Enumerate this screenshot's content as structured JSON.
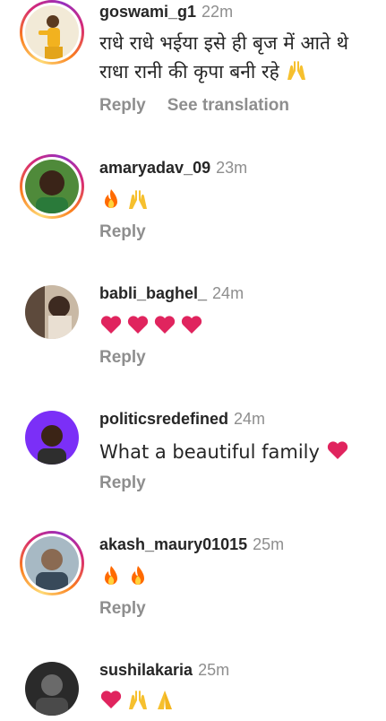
{
  "comments": [
    {
      "username": "goswami_g1",
      "time": "22m",
      "text": "राधे राधे भईया इसे ही बृज में आते थे राधा रानी की कृपा बनी रहे",
      "emojis": [
        "raising-hands"
      ],
      "reply_label": "Reply",
      "translate_label": "See translation",
      "has_story_ring": true
    },
    {
      "username": "amaryadav_09",
      "time": "23m",
      "text": "",
      "emojis": [
        "fire",
        "raising-hands"
      ],
      "reply_label": "Reply",
      "has_story_ring": true
    },
    {
      "username": "babli_baghel_",
      "time": "24m",
      "text": "",
      "emojis": [
        "red-heart",
        "red-heart",
        "red-heart",
        "red-heart"
      ],
      "reply_label": "Reply",
      "has_story_ring": false
    },
    {
      "username": "politicsredefined",
      "time": "24m",
      "text": "What a beautiful family",
      "emojis": [
        "red-heart"
      ],
      "reply_label": "Reply",
      "has_story_ring": false
    },
    {
      "username": "akash_maury01015",
      "time": "25m",
      "text": "",
      "emojis": [
        "fire",
        "fire"
      ],
      "reply_label": "Reply",
      "has_story_ring": true
    },
    {
      "username": "sushilakaria",
      "time": "25m",
      "text": "",
      "emojis": [
        "red-heart",
        "raising-hands",
        "folded-hands"
      ],
      "has_story_ring": false
    }
  ],
  "colors": {
    "text": "#262626",
    "muted": "#8e8e8e",
    "heart": "#e0245e",
    "fire": "#ff6a00",
    "hands": "#f6c02e"
  }
}
